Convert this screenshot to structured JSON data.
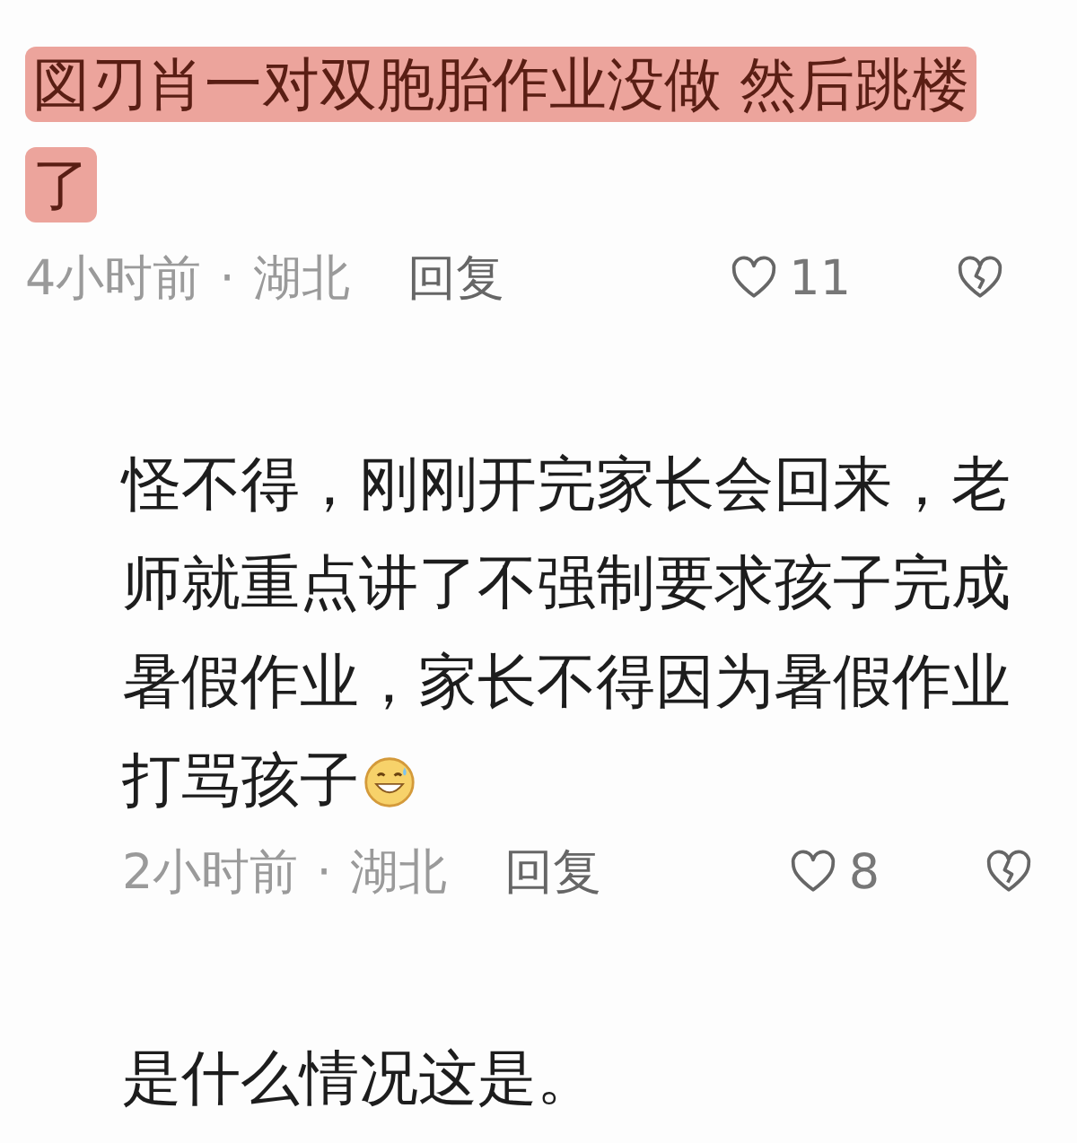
{
  "comments": [
    {
      "text": "図刃肖一对双胞胎作业没做 然后跳楼了",
      "highlighted": true,
      "emoji": false,
      "indented": false,
      "meta": {
        "time": "4小时前",
        "separator": "·",
        "location": "湖北",
        "reply": "回复",
        "likes": "11"
      }
    },
    {
      "text": "怪不得，刚刚开完家长会回来，老师就重点讲了不强制要求孩子完成暑假作业，家长不得因为暑假作业打骂孩子",
      "highlighted": false,
      "emoji": true,
      "indented": true,
      "meta": {
        "time": "2小时前",
        "separator": "·",
        "location": "湖北",
        "reply": "回复",
        "likes": "8"
      }
    },
    {
      "text": "是什么情况这是。",
      "highlighted": false,
      "emoji": false,
      "indented": true
    }
  ]
}
